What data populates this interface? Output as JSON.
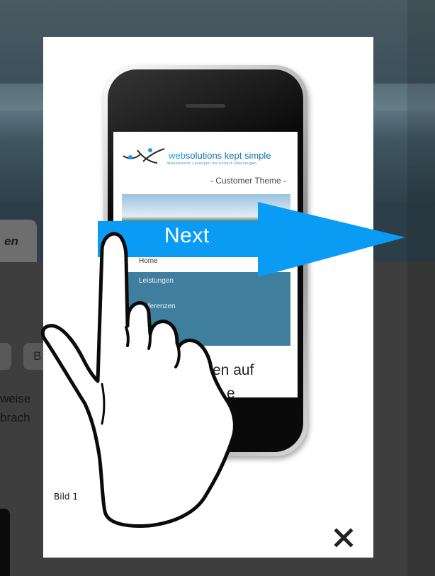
{
  "background": {
    "tab_label": "en",
    "button_label": "B",
    "text_line1": "weise",
    "text_line2": "brach"
  },
  "lightbox": {
    "caption": "Bild 1",
    "close_label": "✕"
  },
  "phone_screen": {
    "brand_part1": "web",
    "brand_part2": "solutions",
    "brand_part3": "kept simple",
    "brand_tagline": "Webbasierte Lösungen die einfach überzeugen.",
    "theme_label": "- Customer Theme -",
    "menu": [
      "Home",
      "Leistungen",
      "Referenzen"
    ],
    "heading_line1": "en auf",
    "heading_line2": "e"
  },
  "overlay": {
    "next_label": "Next",
    "arrow_color": "#0a9cf5"
  }
}
